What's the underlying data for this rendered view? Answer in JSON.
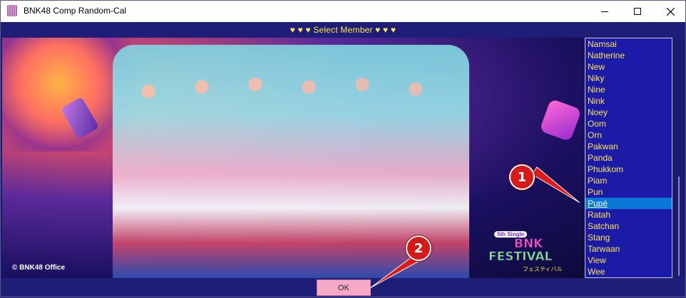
{
  "window": {
    "title": "BNK48 Comp Random-Cal",
    "minimize_icon": "minimize-icon",
    "maximize_icon": "maximize-icon",
    "close_icon": "close-icon"
  },
  "header": {
    "text": "♥ ♥ ♥   Select Member   ♥ ♥ ♥"
  },
  "photo": {
    "copyright": "© BNK48 Office",
    "festival_small": "5th Single",
    "festival_line1": "BNK",
    "festival_line2": "FESTIVAL",
    "festival_jp": "フェスティバル"
  },
  "member_list": {
    "items": [
      "Namsai",
      "Natherine",
      "New",
      "Niky",
      "Nine",
      "Nink",
      "Noey",
      "Oom",
      "Orn",
      "Pakwan",
      "Panda",
      "Phukkom",
      "Piam",
      "Pun",
      "Pupé",
      "Ratah",
      "Satchan",
      "Stang",
      "Tarwaan",
      "View",
      "Wee"
    ],
    "selected": "Pupé"
  },
  "ok_button": {
    "label": "OK"
  },
  "markers": {
    "one": "1",
    "two": "2"
  },
  "colors": {
    "list_text": "#ffe44d",
    "list_bg": "#1b1ba8",
    "selected_bg": "#0a78d7",
    "ok_bg": "#f7a8c4",
    "marker": "#d61a1a"
  }
}
